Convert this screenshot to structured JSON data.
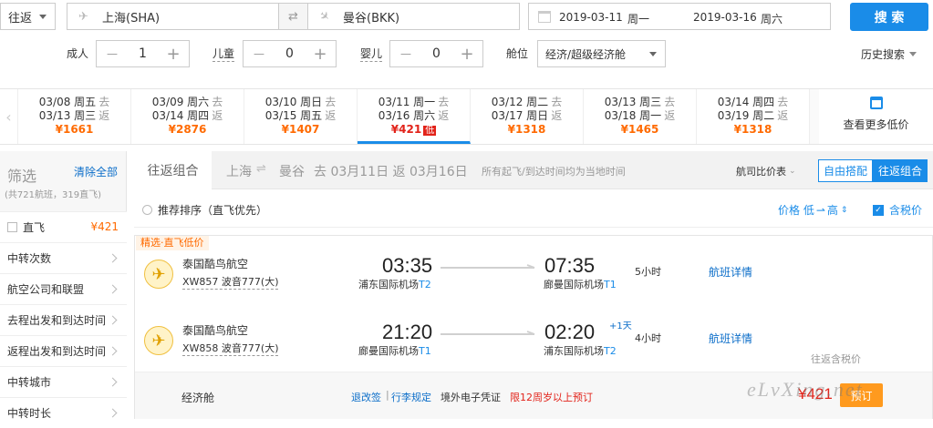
{
  "search": {
    "trip_type": "往返",
    "from_city": "上海(SHA)",
    "to_city": "曼谷(BKK)",
    "depart_date": "2019-03-11",
    "depart_weekday": "周一",
    "return_date": "2019-03-16",
    "return_weekday": "周六",
    "search_label": "搜 索",
    "adult_label": "成人",
    "adult_count": "1",
    "child_label": "儿童",
    "child_count": "0",
    "infant_label": "婴儿",
    "infant_count": "0",
    "cabin_label": "舱位",
    "cabin_value": "经济/超级经济舱",
    "history_label": "历史搜索",
    "minus": "—",
    "plus": "+"
  },
  "date_strip": [
    {
      "go": "03/08 周五",
      "back": "03/13 周三",
      "price": "¥1661"
    },
    {
      "go": "03/09 周六",
      "back": "03/14 周四",
      "price": "¥2876"
    },
    {
      "go": "03/10 周日",
      "back": "03/15 周五",
      "price": "¥1407"
    },
    {
      "go": "03/11 周一",
      "back": "03/16 周六",
      "price": "¥421",
      "badge": "低"
    },
    {
      "go": "03/12 周二",
      "back": "03/17 周日",
      "price": "¥1318"
    },
    {
      "go": "03/13 周三",
      "back": "03/18 周一",
      "price": "¥1465"
    },
    {
      "go": "03/14 周四",
      "back": "03/19 周二",
      "price": "¥1318"
    }
  ],
  "date_strip_go_tag": "去",
  "date_strip_back_tag": "返",
  "more_prices": "查看更多低价",
  "filter": {
    "title": "筛选",
    "clear": "清除全部",
    "summary": "(共721航班，319直飞)",
    "direct_label": "直飞",
    "direct_price": "¥421",
    "items": [
      "中转次数",
      "航空公司和联盟",
      "去程出发和到达时间",
      "返程出发和到达时间",
      "中转城市",
      "中转时长"
    ]
  },
  "main": {
    "tab_title": "往返组合",
    "route_from": "上海",
    "route_to": "曼谷",
    "route_dates": "去 03月11日 返 03月16日",
    "note": "所有起飞/到达时间均为当地时间",
    "compare": "航司比价表",
    "mode_free": "自由搭配",
    "mode_round": "往返组合",
    "sort_label": "推荐排序（直飞优先）",
    "price_sort": "价格 低",
    "price_sort_high": "高",
    "tax_label": "含税价",
    "tag": "精选·直飞低价",
    "flights": [
      {
        "airline": "泰国酷鸟航空",
        "flight": "XW857 波音777(大)",
        "dep_time": "03:35",
        "dep_airport": "浦东国际机场",
        "dep_term": "T2",
        "arr_time": "07:35",
        "arr_airport": "廊曼国际机场",
        "arr_term": "T1",
        "plus": "",
        "duration": "5小时",
        "detail": "航班详情"
      },
      {
        "airline": "泰国酷鸟航空",
        "flight": "XW858 波音777(大)",
        "dep_time": "21:20",
        "dep_airport": "廊曼国际机场",
        "dep_term": "T1",
        "arr_time": "02:20",
        "arr_airport": "浦东国际机场",
        "arr_term": "T2",
        "plus": "+1天",
        "duration": "4小时",
        "detail": "航班详情"
      }
    ],
    "price_note": "往返含税价",
    "cabin": "经济舱",
    "rules1": "退改签",
    "rules2": "行李规定",
    "voucher": "境外电子凭证",
    "age_limit": "限12周岁以上预订",
    "price": "¥421",
    "book": "预订",
    "watermark": "eLvXing.net"
  },
  "colors": {
    "accent": "#1a8ce8",
    "price": "#ff6a00",
    "warn": "#e2231a"
  }
}
